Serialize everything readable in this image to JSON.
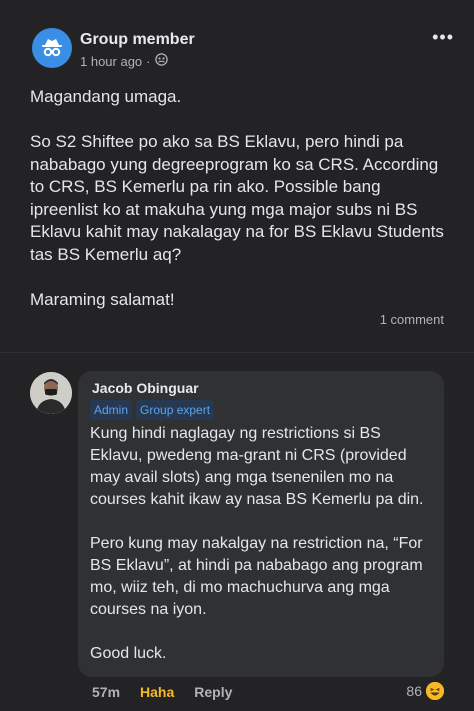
{
  "post": {
    "author": "Group member",
    "time": "1 hour ago",
    "more_label": "•••",
    "paragraphs": [
      "Magandang umaga.",
      "So S2 Shiftee po ako sa BS Eklavu, pero hindi pa nababago yung degreeprogram ko sa CRS. According to CRS, BS Kemerlu pa rin ako. Possible bang ipreenlist ko at makuha yung mga major subs ni BS Eklavu kahit may nakalagay na for BS Eklavu Students tas BS Kemerlu aq?",
      "Maraming salamat!"
    ],
    "comment_count": "1 comment"
  },
  "comment": {
    "author": "Jacob Obinguar",
    "badges": [
      "Admin",
      "Group expert"
    ],
    "paragraphs": [
      "Kung hindi naglagay ng restrictions si BS Eklavu, pwedeng ma-grant ni CRS (provided may avail slots) ang mga tsenenilen mo na courses kahit ikaw ay nasa BS Kemerlu pa din.",
      "Pero kung may nakalgay na restriction na, “For BS Eklavu”, at hindi pa nababago ang program mo, wiiz teh, di mo machuchurva ang mga courses na iyon.",
      "Good luck."
    ],
    "time": "57m",
    "reaction_label": "Haha",
    "reply_label": "Reply",
    "reaction_count": "86"
  },
  "colors": {
    "background": "#232325",
    "bubble": "#303133",
    "badge_text": "#5ea2f0",
    "haha": "#f7b928",
    "avatar_blue": "#3a8ee6"
  },
  "icons": {
    "post_avatar": "anonymous-member-icon",
    "privacy": "group-icon",
    "reaction": "haha-emoji-icon"
  }
}
